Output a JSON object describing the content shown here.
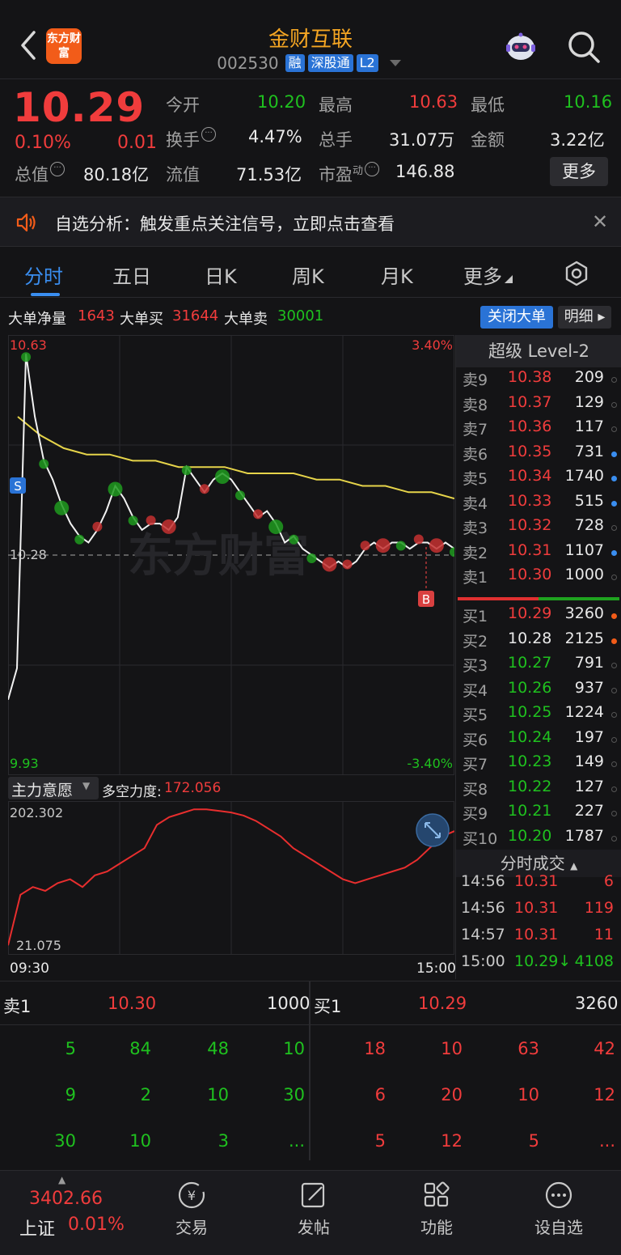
{
  "header": {
    "logo_text": "东方财富",
    "title": "金财互联",
    "code": "002530",
    "tags": [
      "融",
      "深股通",
      "L2"
    ]
  },
  "quote": {
    "price": "10.29",
    "pct": "0.10%",
    "change": "0.01",
    "stats": {
      "open_label": "今开",
      "open": "10.20",
      "high_label": "最高",
      "high": "10.63",
      "low_label": "最低",
      "low": "10.16",
      "turnover_label": "换手",
      "turnover": "4.47%",
      "volume_label": "总手",
      "volume": "31.07万",
      "amount_label": "金额",
      "amount": "3.22亿",
      "mcap_label": "总值",
      "mcap": "80.18亿",
      "float_label": "流值",
      "float": "71.53亿",
      "pe_label": "市盈",
      "pe_sup": "动",
      "pe": "146.88"
    },
    "more_label": "更多"
  },
  "notice": {
    "text": "自选分析：触发重点关注信号，立即点击查看"
  },
  "tabs": [
    "分时",
    "五日",
    "日K",
    "周K",
    "月K",
    "更多"
  ],
  "bigorder": {
    "net_label": "大单净量",
    "net": "1643",
    "buy_label": "大单买",
    "buy": "31644",
    "sell_label": "大单卖",
    "sell": "30001",
    "close_label": "关闭大单",
    "detail_label": "明细"
  },
  "chart_labels": {
    "top_price": "10.63",
    "top_pct": "3.40%",
    "mid_price": "10.28",
    "bottom_price": "9.93",
    "bottom_pct": "-3.40%",
    "s_marker": "S",
    "b_marker": "B",
    "watermark": "东方财富",
    "indicator_label": "主力意愿",
    "indicator_value_label": "多空力度:",
    "indicator_value": "172.056",
    "sub_top": "202.302",
    "sub_bottom": "21.075",
    "time_start": "09:30",
    "time_end": "15:00"
  },
  "chart_data": {
    "type": "line",
    "ylim": [
      9.93,
      10.63
    ],
    "series": [
      {
        "values": [
          10.05,
          10.1,
          10.6,
          10.5,
          10.43,
          10.4,
          10.36,
          10.33,
          10.31,
          10.3,
          10.32,
          10.35,
          10.39,
          10.37,
          10.34,
          10.32,
          10.33,
          10.33,
          10.32,
          10.34,
          10.42,
          10.4,
          10.38,
          10.4,
          10.41,
          10.4,
          10.38,
          10.36,
          10.34,
          10.35,
          10.33,
          10.3,
          10.31,
          10.29,
          10.28,
          10.27,
          10.26,
          10.27,
          10.26,
          10.27,
          10.29,
          10.3,
          10.29,
          10.3,
          10.3,
          10.29,
          10.3,
          10.3,
          10.29,
          10.3,
          10.29
        ]
      },
      {
        "values": [
          10.5,
          10.47,
          10.45,
          10.44,
          10.44,
          10.43,
          10.43,
          10.42,
          10.42,
          10.42,
          10.41,
          10.41,
          10.41,
          10.4,
          10.4,
          10.39,
          10.39,
          10.38,
          10.38,
          10.37
        ]
      }
    ]
  },
  "indicator_data": {
    "type": "line",
    "ylim": [
      21.075,
      202.302
    ],
    "values": [
      25,
      90,
      100,
      95,
      105,
      110,
      100,
      115,
      120,
      130,
      140,
      150,
      180,
      190,
      195,
      200,
      200,
      198,
      196,
      192,
      185,
      175,
      165,
      150,
      140,
      130,
      120,
      110,
      105,
      110,
      115,
      120,
      125,
      135,
      150,
      165,
      172
    ]
  },
  "level2": {
    "title": "超级 Level-2",
    "asks": [
      {
        "k": "卖9",
        "p": "10.38",
        "v": "209",
        "c": "red",
        "dot": "none"
      },
      {
        "k": "卖8",
        "p": "10.37",
        "v": "129",
        "c": "red",
        "dot": "none"
      },
      {
        "k": "卖7",
        "p": "10.36",
        "v": "117",
        "c": "red",
        "dot": "none"
      },
      {
        "k": "卖6",
        "p": "10.35",
        "v": "731",
        "c": "red",
        "dot": "blue"
      },
      {
        "k": "卖5",
        "p": "10.34",
        "v": "1740",
        "c": "red",
        "dot": "blue"
      },
      {
        "k": "卖4",
        "p": "10.33",
        "v": "515",
        "c": "red",
        "dot": "blue"
      },
      {
        "k": "卖3",
        "p": "10.32",
        "v": "728",
        "c": "red",
        "dot": "none"
      },
      {
        "k": "卖2",
        "p": "10.31",
        "v": "1107",
        "c": "red",
        "dot": "blue"
      },
      {
        "k": "卖1",
        "p": "10.30",
        "v": "1000",
        "c": "red",
        "dot": "none"
      }
    ],
    "bids": [
      {
        "k": "买1",
        "p": "10.29",
        "v": "3260",
        "c": "red",
        "dot": "orange"
      },
      {
        "k": "买2",
        "p": "10.28",
        "v": "2125",
        "c": "white",
        "dot": "orange"
      },
      {
        "k": "买3",
        "p": "10.27",
        "v": "791",
        "c": "green",
        "dot": "none"
      },
      {
        "k": "买4",
        "p": "10.26",
        "v": "937",
        "c": "green",
        "dot": "none"
      },
      {
        "k": "买5",
        "p": "10.25",
        "v": "1224",
        "c": "green",
        "dot": "none"
      },
      {
        "k": "买6",
        "p": "10.24",
        "v": "197",
        "c": "green",
        "dot": "none"
      },
      {
        "k": "买7",
        "p": "10.23",
        "v": "149",
        "c": "green",
        "dot": "none"
      },
      {
        "k": "买8",
        "p": "10.22",
        "v": "127",
        "c": "green",
        "dot": "none"
      },
      {
        "k": "买9",
        "p": "10.21",
        "v": "227",
        "c": "green",
        "dot": "none"
      },
      {
        "k": "买10",
        "p": "10.20",
        "v": "1787",
        "c": "green",
        "dot": "none"
      }
    ],
    "ticks_title": "分时成交",
    "ticks": [
      {
        "t": "14:56",
        "p": "10.31",
        "v": "6",
        "c": "red"
      },
      {
        "t": "14:56",
        "p": "10.31",
        "v": "119",
        "c": "red"
      },
      {
        "t": "14:57",
        "p": "10.31",
        "v": "11",
        "c": "red"
      },
      {
        "t": "15:00",
        "p": "10.29↓",
        "v": "4108",
        "c": "green"
      }
    ]
  },
  "book": {
    "sell_label": "卖1",
    "sell_price": "10.30",
    "sell_vol": "1000",
    "buy_label": "买1",
    "buy_price": "10.29",
    "buy_vol": "3260",
    "sell_rows": [
      [
        "5",
        "84",
        "48",
        "10"
      ],
      [
        "9",
        "2",
        "10",
        "30"
      ],
      [
        "30",
        "10",
        "3",
        "..."
      ]
    ],
    "buy_rows": [
      [
        "18",
        "10",
        "63",
        "42"
      ],
      [
        "6",
        "20",
        "10",
        "12"
      ],
      [
        "5",
        "12",
        "5",
        "..."
      ]
    ]
  },
  "nav": {
    "index_value": "3402.66",
    "index_name": "上证",
    "index_pct": "0.01%",
    "items": [
      "交易",
      "发帖",
      "功能",
      "设自选"
    ]
  }
}
